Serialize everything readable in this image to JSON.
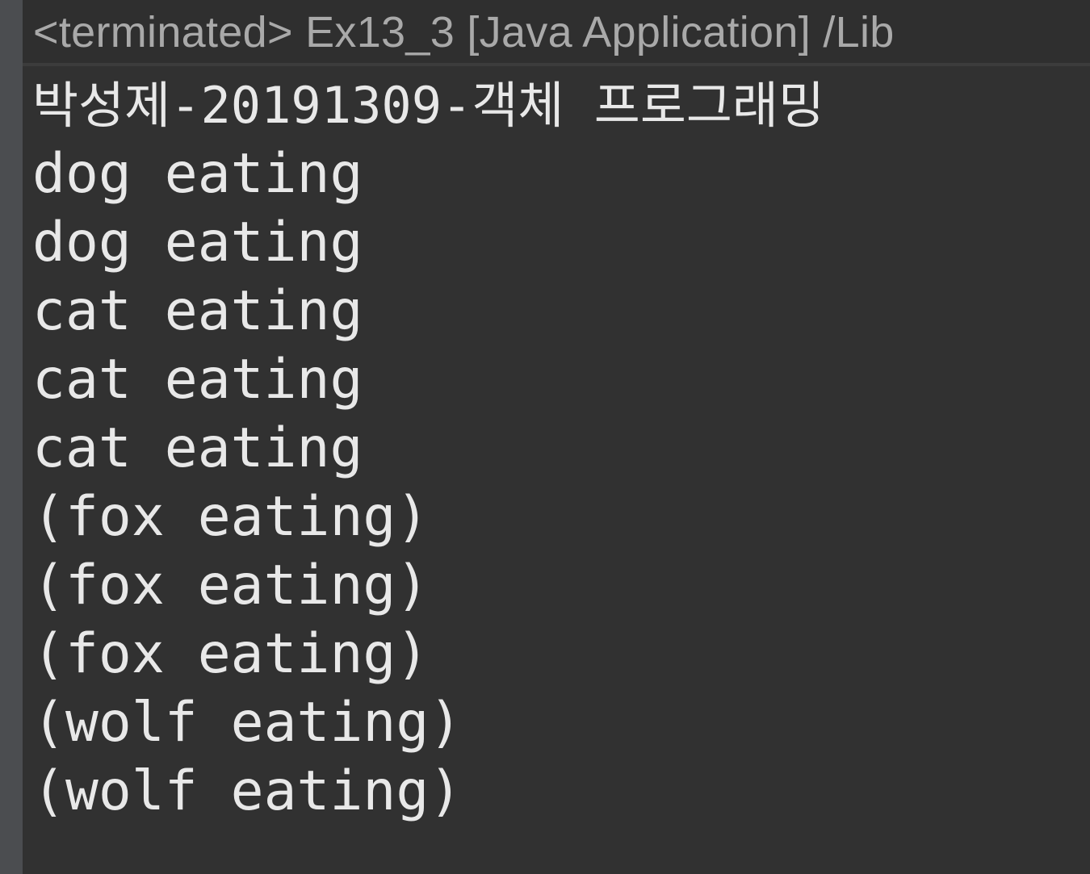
{
  "console": {
    "header": "<terminated> Ex13_3 [Java Application] /Lib",
    "lines": [
      "박성제-20191309-객체 프로그래밍",
      "dog eating",
      "dog eating",
      "cat eating",
      "cat eating",
      "cat eating",
      "(fox eating)",
      "(fox eating)",
      "(fox eating)",
      "(wolf eating)",
      "(wolf eating)"
    ]
  }
}
